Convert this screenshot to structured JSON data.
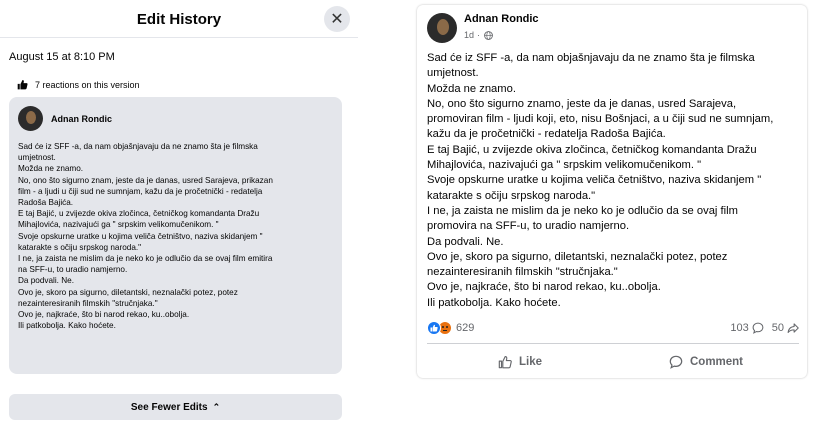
{
  "edit_history": {
    "title": "Edit History",
    "close_icon": "close-icon",
    "version_date": "August 15 at 8:10 PM",
    "reactions_text": "7 reactions on this version",
    "author": "Adnan Rondic",
    "lines": [
      "Sad će iz SFF -a, da nam objašnjavaju da ne znamo šta je filmska",
      "umjetnost.",
      "Možda ne znamo.",
      "No, ono što sigurno znam, jeste da je danas, usred Sarajeva, prikazan",
      "film - a ljudi u čiji sud ne sumnjam, kažu da je pročetnički - redatelja",
      "Radoša Bajića.",
      "E taj Bajić, u zvijezde okiva zločinca, četničkog komandanta Dražu",
      "Mihajlovića, nazivajući ga \" srpskim velikomučenikom. \"",
      "Svoje opskurne uratke u kojima veliča četništvo, naziva skidanjem \"",
      "katarakte s očiju srpskog naroda.\"",
      "I ne, ja zaista ne mislim da je neko ko je odlučio da se ovaj film emitira",
      "na SFF-u, to uradio namjerno.",
      "Da podvali. Ne.",
      "Ovo je, skoro pa sigurno, diletantski, neznalački potez, potez",
      "nezainteresiranih filmskih \"stručnjaka.\"",
      "Ovo je, najkraće, što bi narod rekao, ku..obolja.",
      "Ili patkobolja. Kako hoćete."
    ],
    "see_fewer_label": "See Fewer Edits"
  },
  "post": {
    "author": "Adnan Rondic",
    "time": "1d",
    "lines": [
      "Sad će iz SFF -a, da nam objašnjavaju da ne znamo šta je filmska",
      "umjetnost.",
      "Možda ne znamo.",
      "No, ono što sigurno znamo, jeste da je danas, usred Sarajeva,",
      "promoviran film - ljudi koji, eto, nisu Bošnjaci, a u čiji sud ne sumnjam,",
      "kažu da je pročetnički - redatelja Radoša Bajića.",
      "E taj Bajić, u zvijezde okiva zločinca, četničkog komandanta Dražu",
      "Mihajlovića, nazivajući ga \" srpskim velikomučenikom. \"",
      "Svoje opskurne uratke u kojima veliča četništvo, naziva skidanjem \"",
      "katarakte s očiju srpskog naroda.\"",
      "I ne, ja zaista ne mislim da je neko ko je odlučio da se ovaj film",
      "promovira na SFF-u, to uradio namjerno.",
      "Da podvali. Ne.",
      "Ovo je, skoro pa sigurno, diletantski, neznalački potez, potez",
      "nezainteresiranih filmskih \"stručnjaka.\"",
      "Ovo je, najkraće, što bi narod rekao, ku..obolja.",
      "Ili patkobolja. Kako hoćete."
    ],
    "reaction_count": "629",
    "comment_count": "103",
    "share_count": "50",
    "like_label": "Like",
    "comment_label": "Comment"
  },
  "colors": {
    "like_blue": "#1877f2",
    "angry_orange": "#e9710f",
    "secondary_text": "#65676b",
    "card_bg": "#e4e6eb"
  }
}
